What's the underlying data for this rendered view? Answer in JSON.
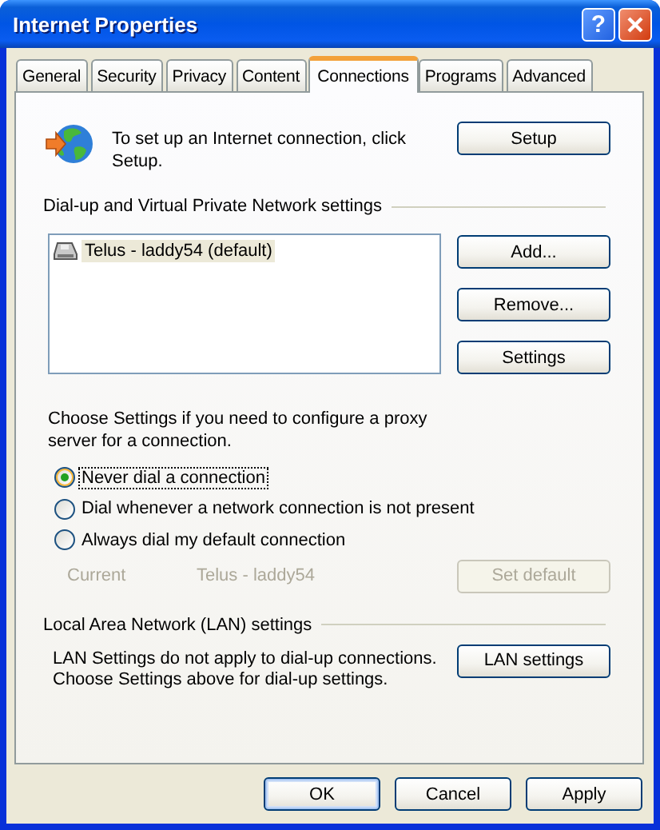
{
  "window": {
    "title": "Internet Properties",
    "help_button": "?"
  },
  "tabs": [
    {
      "label": "General",
      "selected": false
    },
    {
      "label": "Security",
      "selected": false
    },
    {
      "label": "Privacy",
      "selected": false
    },
    {
      "label": "Content",
      "selected": false
    },
    {
      "label": "Connections",
      "selected": true
    },
    {
      "label": "Programs",
      "selected": false
    },
    {
      "label": "Advanced",
      "selected": false
    }
  ],
  "setup": {
    "text": "To set up an Internet connection, click Setup.",
    "button": "Setup"
  },
  "dialup": {
    "heading": "Dial-up and Virtual Private Network settings",
    "connections": [
      {
        "name": "Telus - laddy54 (default)",
        "selected": true
      }
    ],
    "buttons": [
      "Add...",
      "Remove...",
      "Settings"
    ]
  },
  "proxy": {
    "text": "Choose Settings if you need to configure a proxy server for a connection.",
    "options": [
      {
        "label": "Never dial a connection",
        "selected": true
      },
      {
        "label": "Dial whenever a network connection is not present",
        "selected": false
      },
      {
        "label": "Always dial my default connection",
        "selected": false
      }
    ],
    "current_label": "Current",
    "current_value": "Telus - laddy54",
    "set_default": {
      "label": "Set default",
      "disabled": true
    }
  },
  "lan": {
    "heading": "Local Area Network (LAN) settings",
    "text": "LAN Settings do not apply to dial-up connections. Choose Settings above for dial-up settings.",
    "button": "LAN settings"
  },
  "footer_buttons": [
    "OK",
    "Cancel",
    "Apply"
  ]
}
